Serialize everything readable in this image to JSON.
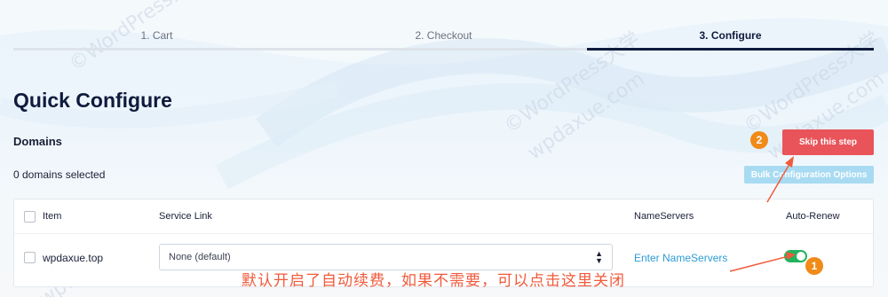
{
  "steps": [
    {
      "label": "1. Cart",
      "state": "completed"
    },
    {
      "label": "2. Checkout",
      "state": "completed"
    },
    {
      "label": "3. Configure",
      "state": "active"
    }
  ],
  "page": {
    "title": "Quick Configure",
    "section_title": "Domains",
    "selected_count": "0 domains selected"
  },
  "buttons": {
    "skip": "Skip this step",
    "bulk": "Bulk Configuration Options"
  },
  "table": {
    "headers": {
      "item": "Item",
      "service_link": "Service Link",
      "nameservers": "NameServers",
      "auto_renew": "Auto-Renew"
    },
    "rows": [
      {
        "domain": "wpdaxue.top",
        "service_link": "None (default)",
        "nameservers_link": "Enter NameServers",
        "auto_renew": true
      }
    ]
  },
  "annotations": {
    "badge_1": "1",
    "badge_2": "2",
    "note": "默认开启了自动续费，如果不需要，可以点击这里关闭"
  },
  "watermark": {
    "text_1": "©WordPress大学",
    "text_2": "wpdaxue.com"
  },
  "colors": {
    "accent_navy": "#0f1b3d",
    "skip_red": "#e9545a",
    "bulk_blue": "#a8dbf2",
    "link_blue": "#2d9bd6",
    "toggle_green": "#22b35e",
    "annotation_orange": "#f08a18",
    "annotation_text": "#f05a3b"
  }
}
